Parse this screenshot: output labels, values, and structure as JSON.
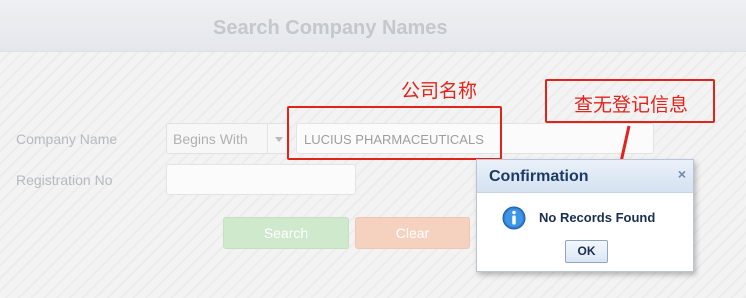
{
  "page": {
    "title": "Search Company Names"
  },
  "form": {
    "company_name_label": "Company Name",
    "match_mode": "Begins With",
    "company_name_value": "LUCIUS PHARMACEUTICALS",
    "registration_label": "Registration No",
    "registration_value": "",
    "search_label": "Search",
    "clear_label": "Clear"
  },
  "annotations": {
    "company_name_note": "公司名称",
    "no_record_note": "查无登记信息",
    "color": "#e2231a"
  },
  "dialog": {
    "title": "Confirmation",
    "close_icon": "×",
    "message": "No Records Found",
    "ok_label": "OK",
    "icon": "info-icon"
  }
}
